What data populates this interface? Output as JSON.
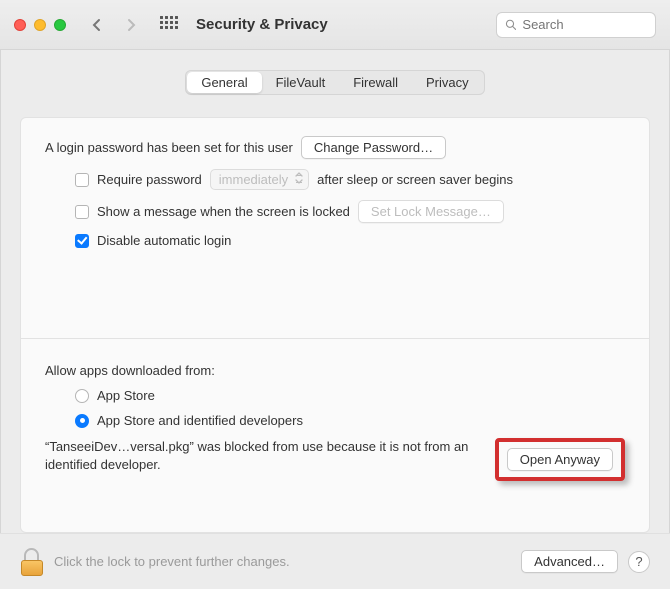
{
  "window": {
    "title": "Security & Privacy"
  },
  "search": {
    "placeholder": "Search"
  },
  "tabs": {
    "items": [
      "General",
      "FileVault",
      "Firewall",
      "Privacy"
    ],
    "selected": 0
  },
  "general": {
    "password_set_text": "A login password has been set for this user",
    "change_password_btn": "Change Password…",
    "require_password_label": "Require password",
    "require_password_delay": "immediately",
    "require_password_suffix": "after sleep or screen saver begins",
    "show_message_label": "Show a message when the screen is locked",
    "set_lock_message_btn": "Set Lock Message…",
    "disable_auto_login_label": "Disable automatic login",
    "allow_apps_heading": "Allow apps downloaded from:",
    "radio_appstore": "App Store",
    "radio_identified": "App Store and identified developers",
    "blocked_message": "“TanseeiDev…versal.pkg” was blocked from use because it is not from an identified developer.",
    "open_anyway_btn": "Open Anyway"
  },
  "footer": {
    "lock_text": "Click the lock to prevent further changes.",
    "advanced_btn": "Advanced…",
    "help": "?"
  }
}
